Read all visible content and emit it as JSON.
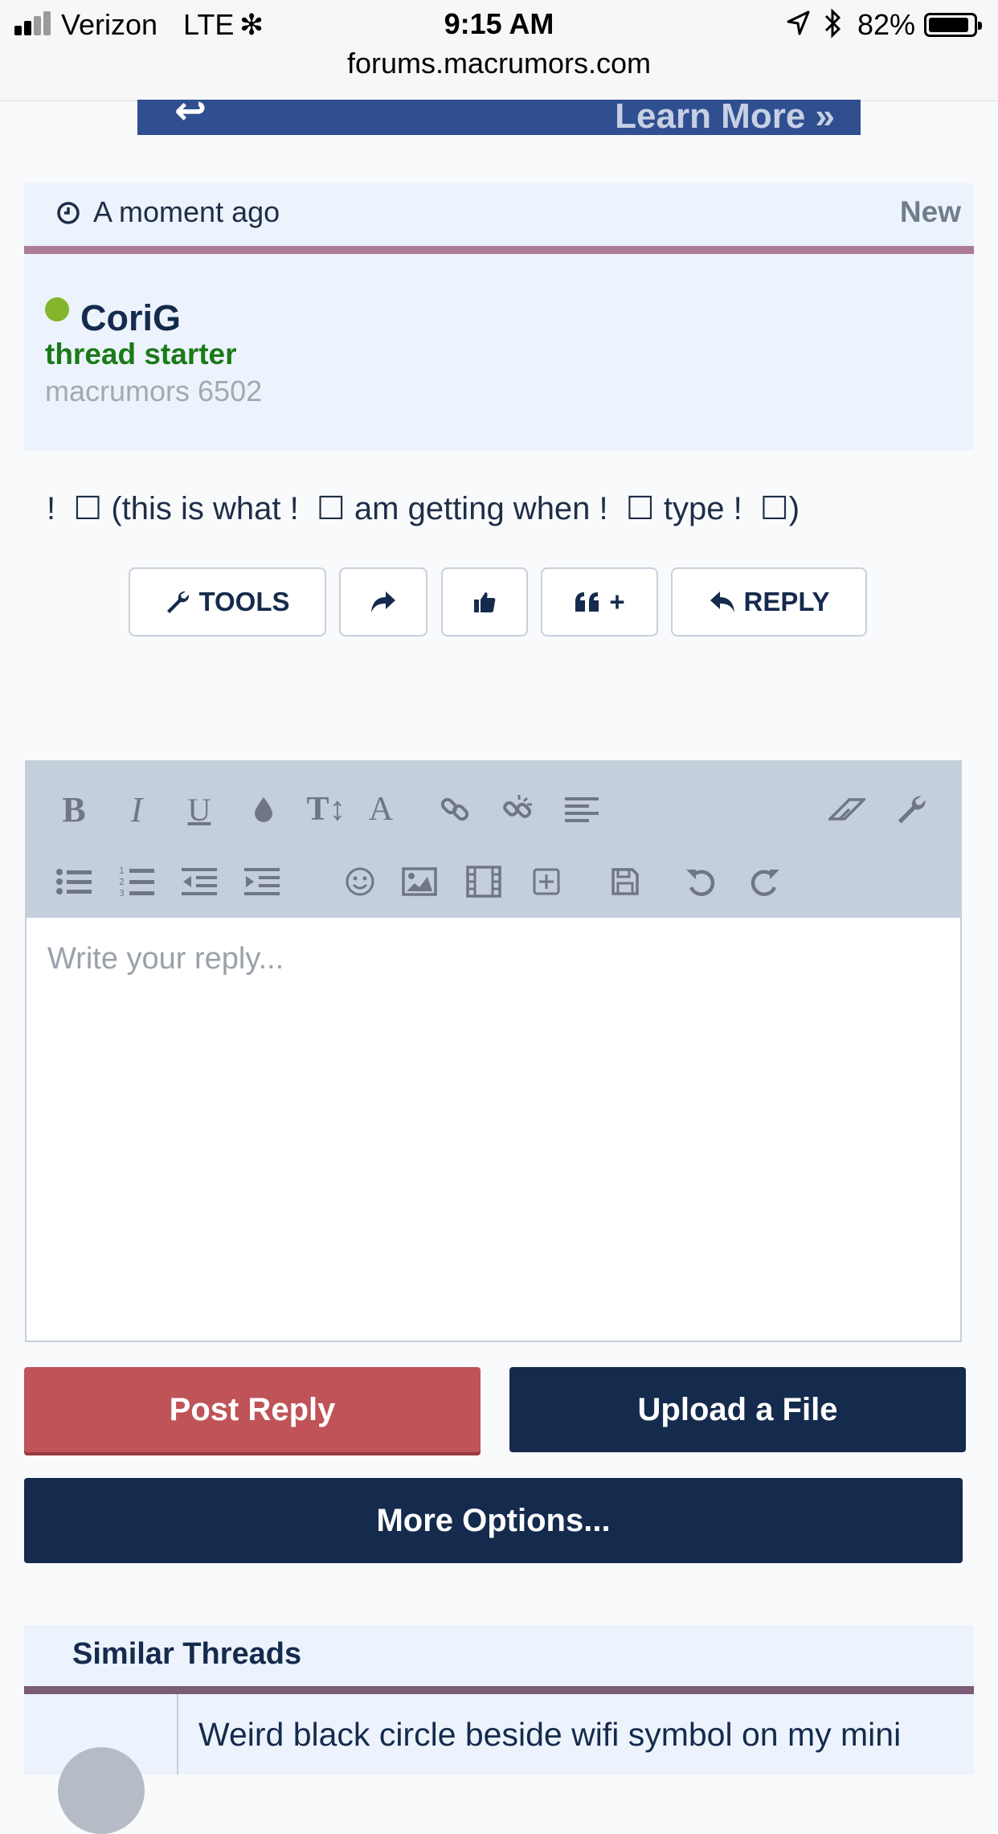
{
  "status_bar": {
    "carrier": "Verizon",
    "network": "LTE",
    "loading_glyph": "✻",
    "time": "9:15 AM",
    "battery_pct": "82%",
    "url": "forums.macrumors.com"
  },
  "ad": {
    "cta": "Learn More »",
    "arrow_glyph": "↩"
  },
  "post": {
    "time": "A moment ago",
    "badge": "New",
    "author": "CoriG",
    "role": "thread starter",
    "rank": "macrumors 6502",
    "message": "!  ☐ (this is what !  ☐ am getting when !  ☐ type !  ☐)"
  },
  "actions": {
    "tools_label": "TOOLS",
    "quote_label": "+",
    "reply_label": "REPLY"
  },
  "editor": {
    "placeholder": "Write your reply...",
    "toolbar_row1": [
      "bold",
      "italic",
      "underline",
      "text-color",
      "font-size",
      "font",
      "link",
      "unlink",
      "align"
    ],
    "toolbar_row1_right": [
      "remove-format",
      "tools"
    ],
    "toolbar_row2": [
      "bullet-list",
      "numbered-list",
      "outdent",
      "indent",
      "smilies",
      "image",
      "media",
      "insert",
      "save-draft",
      "undo",
      "redo"
    ]
  },
  "buttons": {
    "post_reply": "Post Reply",
    "upload_file": "Upload a File",
    "more_options": "More Options..."
  },
  "similar": {
    "title": "Similar Threads",
    "first_thread": "Weird black circle beside wifi symbol on my mini"
  },
  "colors": {
    "navy": "#152b4d",
    "post_reply": "#bf5357",
    "online": "#83b62a",
    "role": "#1a7a18",
    "divider": "#ab7c96"
  }
}
